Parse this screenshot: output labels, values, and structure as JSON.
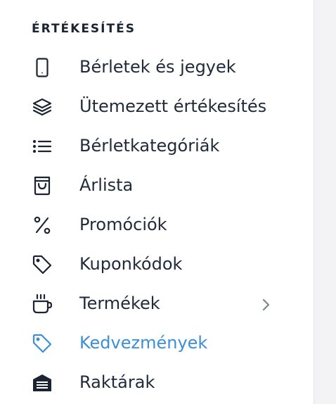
{
  "section": {
    "title": "ÉRTÉKESÍTÉS"
  },
  "menu": {
    "items": [
      {
        "label": "Bérletek és jegyek",
        "icon": "phone-icon"
      },
      {
        "label": "Ütemezett értékesítés",
        "icon": "layers-icon"
      },
      {
        "label": "Bérletkategóriák",
        "icon": "list-icon"
      },
      {
        "label": "Árlista",
        "icon": "shopping-bag-icon"
      },
      {
        "label": "Promóciók",
        "icon": "percent-icon"
      },
      {
        "label": "Kuponkódok",
        "icon": "tag-icon"
      },
      {
        "label": "Termékek",
        "icon": "coffee-cup-icon",
        "has_submenu": true
      },
      {
        "label": "Kedvezmények",
        "icon": "tag-icon",
        "active": true
      },
      {
        "label": "Raktárak",
        "icon": "warehouse-icon"
      }
    ]
  },
  "colors": {
    "text": "#1f2a3a",
    "active": "#3a8fd8",
    "chevron": "#7c8593"
  }
}
